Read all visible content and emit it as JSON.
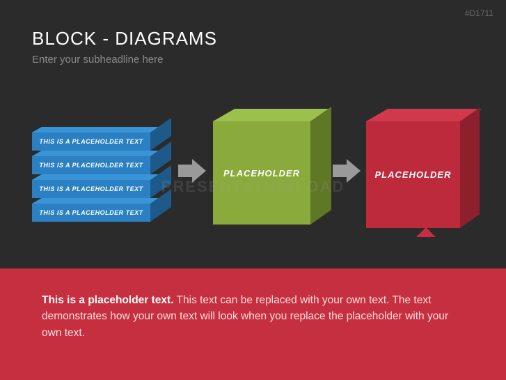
{
  "slide_code": "#D1711",
  "title": "BLOCK - DIAGRAMS",
  "subtitle": "Enter your subheadline here",
  "blue_stack": {
    "slabs": [
      "THIS IS A PLACEHOLDER TEXT",
      "THIS IS A PLACEHOLDER TEXT",
      "THIS IS A PLACEHOLDER TEXT",
      "THIS IS A PLACEHOLDER TEXT"
    ]
  },
  "green_cube": {
    "label": "PLACEHOLDER"
  },
  "red_cube": {
    "label": "PLACEHOLDER"
  },
  "footer": {
    "bold": "This is a placeholder text.",
    "rest": " This text can be replaced with your own text. The text demonstrates how your own text will look when you replace the placeholder with your own text."
  },
  "watermark": "PRESENTATIONLOAD",
  "colors": {
    "bg": "#2b2b2b",
    "blue": "#2a80c2",
    "green": "#8aaa3b",
    "red": "#bd2a3c",
    "footer": "#c62f3f"
  }
}
